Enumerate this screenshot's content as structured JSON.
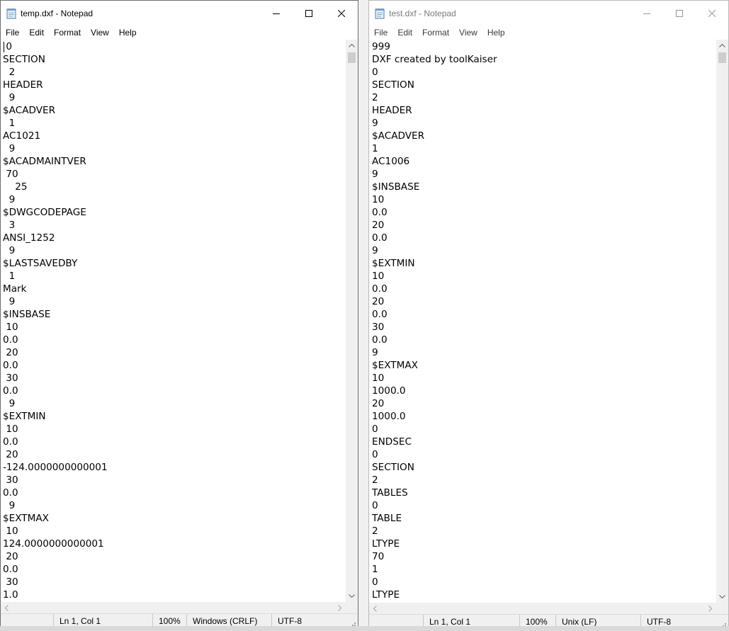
{
  "windows": {
    "left": {
      "title": "temp.dxf - Notepad",
      "menu": [
        "File",
        "Edit",
        "Format",
        "View",
        "Help"
      ],
      "lines": [
        " 0",
        "SECTION",
        "  2",
        "HEADER",
        "  9",
        "$ACADVER",
        "  1",
        "AC1021",
        "  9",
        "$ACADMAINTVER",
        " 70",
        "    25",
        "  9",
        "$DWGCODEPAGE",
        "  3",
        "ANSI_1252",
        "  9",
        "$LASTSAVEDBY",
        "  1",
        "Mark",
        "  9",
        "$INSBASE",
        " 10",
        "0.0",
        " 20",
        "0.0",
        " 30",
        "0.0",
        "  9",
        "$EXTMIN",
        " 10",
        "0.0",
        " 20",
        "-124.0000000000001",
        " 30",
        "0.0",
        "  9",
        "$EXTMAX",
        " 10",
        "124.0000000000001",
        " 20",
        "0.0",
        " 30",
        "1.0"
      ],
      "status": {
        "position": "Ln 1, Col 1",
        "zoom": "100%",
        "line_endings": "Windows (CRLF)",
        "encoding": "UTF-8"
      }
    },
    "right": {
      "title": "test.dxf - Notepad",
      "menu": [
        "File",
        "Edit",
        "Format",
        "View",
        "Help"
      ],
      "lines": [
        "999",
        "DXF created by toolKaiser",
        "0",
        "SECTION",
        "2",
        "HEADER",
        "9",
        "$ACADVER",
        "1",
        "AC1006",
        "9",
        "$INSBASE",
        "10",
        "0.0",
        "20",
        "0.0",
        "9",
        "$EXTMIN",
        "10",
        "0.0",
        "20",
        "0.0",
        "30",
        "0.0",
        "9",
        "$EXTMAX",
        "10",
        "1000.0",
        "20",
        "1000.0",
        "0",
        "ENDSEC",
        "0",
        "SECTION",
        "2",
        "TABLES",
        "0",
        "TABLE",
        "2",
        "LTYPE",
        "70",
        "1",
        "0",
        "LTYPE"
      ],
      "status": {
        "position": "Ln 1, Col 1",
        "zoom": "100%",
        "line_endings": "Unix (LF)",
        "encoding": "UTF-8"
      }
    }
  },
  "icons": {
    "app": "notepad-icon",
    "minimize": "minimize-icon",
    "maximize": "maximize-icon",
    "close": "close-icon"
  },
  "colors": {
    "active_title_text": "#000000",
    "inactive_title_text": "#7a7a7a",
    "chrome": "#f0f0f0"
  }
}
